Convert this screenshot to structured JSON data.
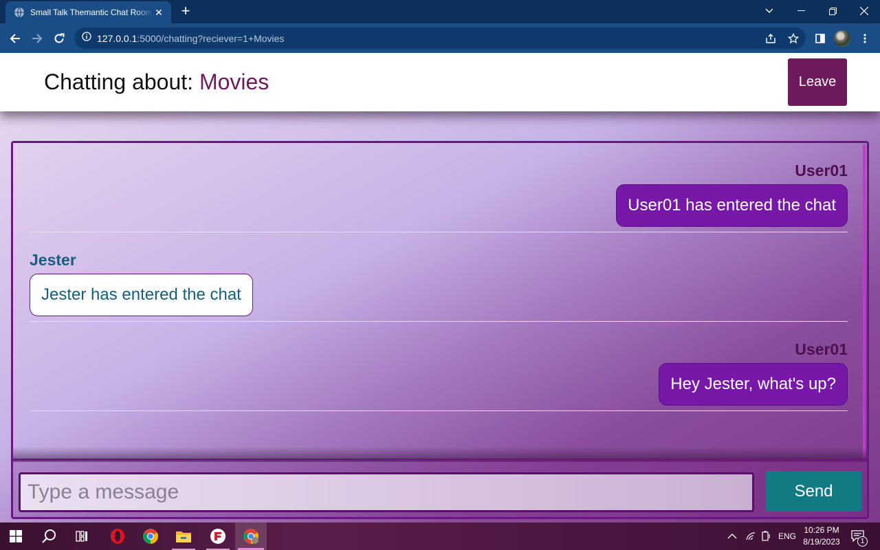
{
  "browser": {
    "tab_title": "Small Talk Themantic Chat Room",
    "url_host": "127.0.0.1",
    "url_path": ":5000/chatting?reciever=1+Movies"
  },
  "header": {
    "title_prefix": "Chatting about: ",
    "room_name": "Movies",
    "leave_label": "Leave"
  },
  "messages": [
    {
      "sender": "User01",
      "text": "User01 has entered the chat",
      "side": "mine"
    },
    {
      "sender": "Jester",
      "text": "Jester has entered the chat",
      "side": "theirs"
    },
    {
      "sender": "User01",
      "text": "Hey Jester, what's up?",
      "side": "mine"
    }
  ],
  "composer": {
    "placeholder": "Type a message",
    "send_label": "Send"
  },
  "taskbar": {
    "language": "ENG",
    "time": "10:26 PM",
    "date": "8/19/2023",
    "notification_count": "1"
  },
  "colors": {
    "accent": "#6e1a5c",
    "bubble_mine": "#7718a9",
    "send": "#117a83",
    "their_name": "#155e80"
  }
}
